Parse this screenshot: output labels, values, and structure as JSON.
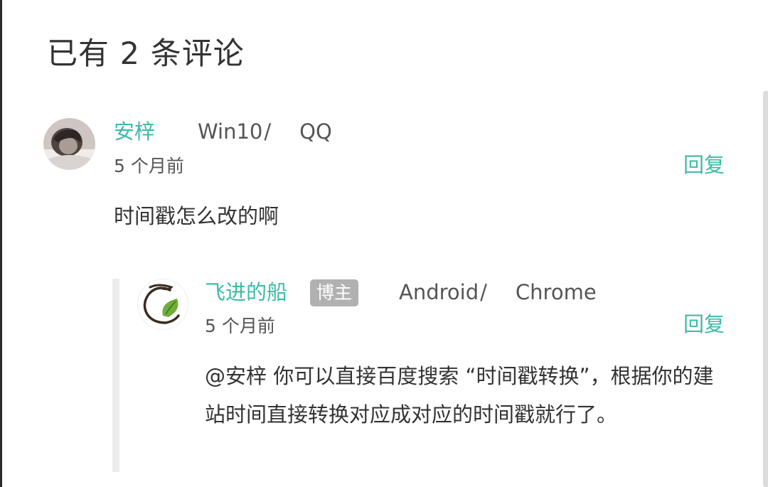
{
  "comments_heading": "已有 2 条评论",
  "comments": [
    {
      "author": "安梓",
      "os": "Win10",
      "browser": "QQ",
      "time": "5 个月前",
      "reply_label": "回复",
      "text": "时间戳怎么改的啊"
    },
    {
      "author": "飞进的船",
      "badge": "博主",
      "os": "Android",
      "browser": "Chrome",
      "time": "5 个月前",
      "reply_label": "回复",
      "text": "@安梓 你可以直接百度搜索 “时间戳转换”，根据你的建站时间直接转换对应成对应的时间戳就行了。"
    }
  ],
  "separator": "/",
  "colors": {
    "accent": "#3cbba6",
    "badge_bg": "#b1b1b1",
    "text": "#333333",
    "muted": "#555555"
  }
}
